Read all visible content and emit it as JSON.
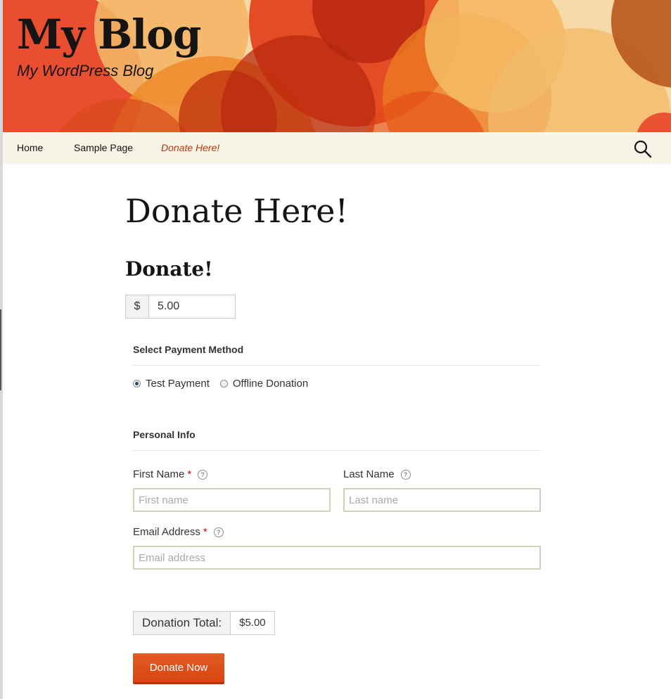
{
  "site": {
    "title": "My Blog",
    "description": "My WordPress Blog"
  },
  "nav": {
    "items": [
      {
        "label": "Home"
      },
      {
        "label": "Sample Page"
      },
      {
        "label": "Donate Here!"
      }
    ],
    "current_index": 2,
    "search_icon": "search-icon"
  },
  "page": {
    "title": "Donate Here!"
  },
  "form": {
    "title": "Donate!",
    "currency_symbol": "$",
    "amount": "5.00",
    "payment": {
      "legend": "Select Payment Method",
      "options": [
        {
          "label": "Test Payment",
          "checked": true
        },
        {
          "label": "Offline Donation",
          "checked": false
        }
      ]
    },
    "personal": {
      "legend": "Personal Info",
      "first_name_label": "First Name",
      "first_name_placeholder": "First name",
      "last_name_label": "Last Name",
      "last_name_placeholder": "Last name",
      "email_label": "Email Address",
      "email_placeholder": "Email address",
      "required_marker": "*",
      "help_glyph": "?"
    },
    "total_label": "Donation Total:",
    "total_value": "$5.00",
    "submit_label": "Donate Now"
  },
  "colors": {
    "accent": "#bc360a",
    "button": "#e05d22",
    "nav_bg": "#f7f5e7"
  }
}
